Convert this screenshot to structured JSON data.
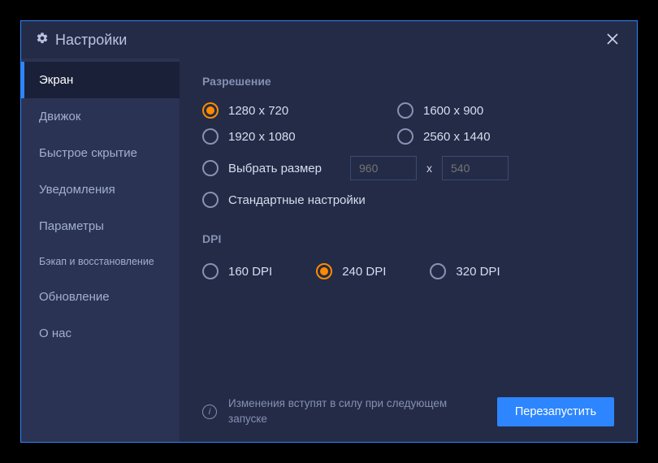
{
  "window": {
    "title": "Настройки"
  },
  "sidebar": {
    "items": [
      {
        "label": "Экран",
        "active": true
      },
      {
        "label": "Движок",
        "active": false
      },
      {
        "label": "Быстрое скрытие",
        "active": false
      },
      {
        "label": "Уведомления",
        "active": false
      },
      {
        "label": "Параметры",
        "active": false
      },
      {
        "label": "Бэкап и восстановление",
        "active": false,
        "small": true
      },
      {
        "label": "Обновление",
        "active": false
      },
      {
        "label": "О нас",
        "active": false
      }
    ]
  },
  "sections": {
    "resolution": {
      "title": "Разрешение",
      "options": [
        {
          "label": "1280 x 720",
          "selected": true
        },
        {
          "label": "1600 x 900",
          "selected": false
        },
        {
          "label": "1920 x 1080",
          "selected": false
        },
        {
          "label": "2560 x 1440",
          "selected": false
        }
      ],
      "custom": {
        "label": "Выбрать размер",
        "width_placeholder": "960",
        "height_placeholder": "540",
        "separator": "x"
      },
      "default_label": "Стандартные настройки"
    },
    "dpi": {
      "title": "DPI",
      "options": [
        {
          "label": "160 DPI",
          "selected": false
        },
        {
          "label": "240 DPI",
          "selected": true
        },
        {
          "label": "320 DPI",
          "selected": false
        }
      ]
    }
  },
  "footer": {
    "message": "Изменения вступят в силу при следующем запуске",
    "restart_label": "Перезапустить"
  },
  "colors": {
    "accent_blue": "#2d86ff",
    "accent_orange": "#ff8a00",
    "bg_dark": "#232b47",
    "bg_sidebar": "#2a3353"
  }
}
